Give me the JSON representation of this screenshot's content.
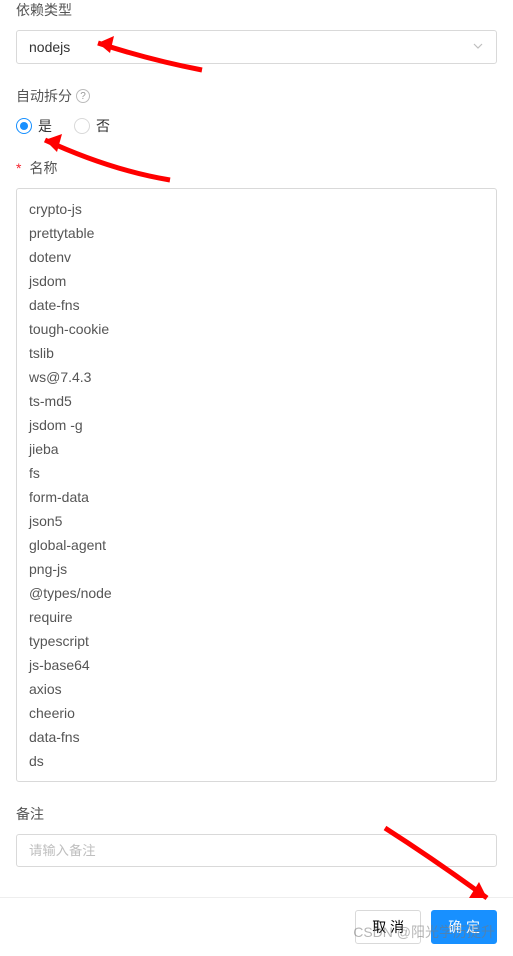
{
  "dependencyType": {
    "label": "依赖类型",
    "value": "nodejs"
  },
  "autoSplit": {
    "label": "自动拆分",
    "options": {
      "yes": "是",
      "no": "否"
    },
    "selected": "yes"
  },
  "name": {
    "label": "名称",
    "value": "crypto-js\nprettytable\ndotenv\njsdom\ndate-fns\ntough-cookie\ntslib\nws@7.4.3\nts-md5\njsdom -g\njieba\nfs\nform-data\njson5\nglobal-agent\npng-js\n@types/node\nrequire\ntypescript\njs-base64\naxios\ncheerio\ndata-fns\nds"
  },
  "remark": {
    "label": "备注",
    "placeholder": "请输入备注",
    "value": ""
  },
  "buttons": {
    "cancel": "取 消",
    "confirm": "确 定"
  },
  "watermark": "CSDN @阳光学历提升"
}
